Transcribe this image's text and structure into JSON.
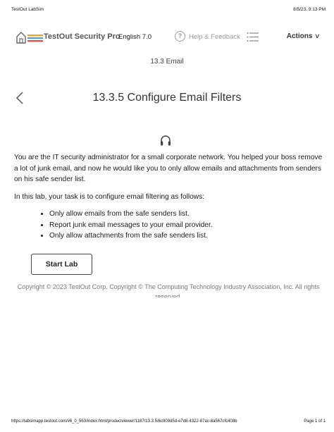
{
  "print_header": {
    "left": "TestOut LabSim",
    "right": "8/5/23, 9:13 PM"
  },
  "topbar": {
    "brand": "TestOut Security Pro",
    "language": "English 7.0",
    "help_label": "Help & Feedback",
    "actions_label": "Actions",
    "brand_colors": {
      "orange": "#f39c1f",
      "blue": "#5b9bd5",
      "red": "#e74c3c"
    }
  },
  "section": {
    "title": "13.3 Email"
  },
  "lesson": {
    "title": "13.3.5 Configure Email Filters"
  },
  "content": {
    "intro": "You are the IT security administrator for a small corporate network. You helped your boss remove a lot of junk email, and now he would like you to only allow emails and attachments from senders on his safe sender list.",
    "task": "In this lab, your task is to configure email filtering as follows:",
    "tasks": [
      "Only allow emails from the safe senders list.",
      "Report junk email messages to your email provider.",
      "Only allow attachments from the safe senders list."
    ]
  },
  "start_button": {
    "label": "Start Lab"
  },
  "copyright": "Copyright © 2023 TestOut Corp. Copyright © The Computing Technology Industry Association, Inc. All rights reserved.",
  "print_footer": {
    "url": "https://labsimapp.testout.com/v6_0_563/index.html/productviewer/1187/13.3.5/6c909d5d-e7d8-4322-87ac-8a567cfc408b",
    "page": "Page 1 of 1"
  }
}
